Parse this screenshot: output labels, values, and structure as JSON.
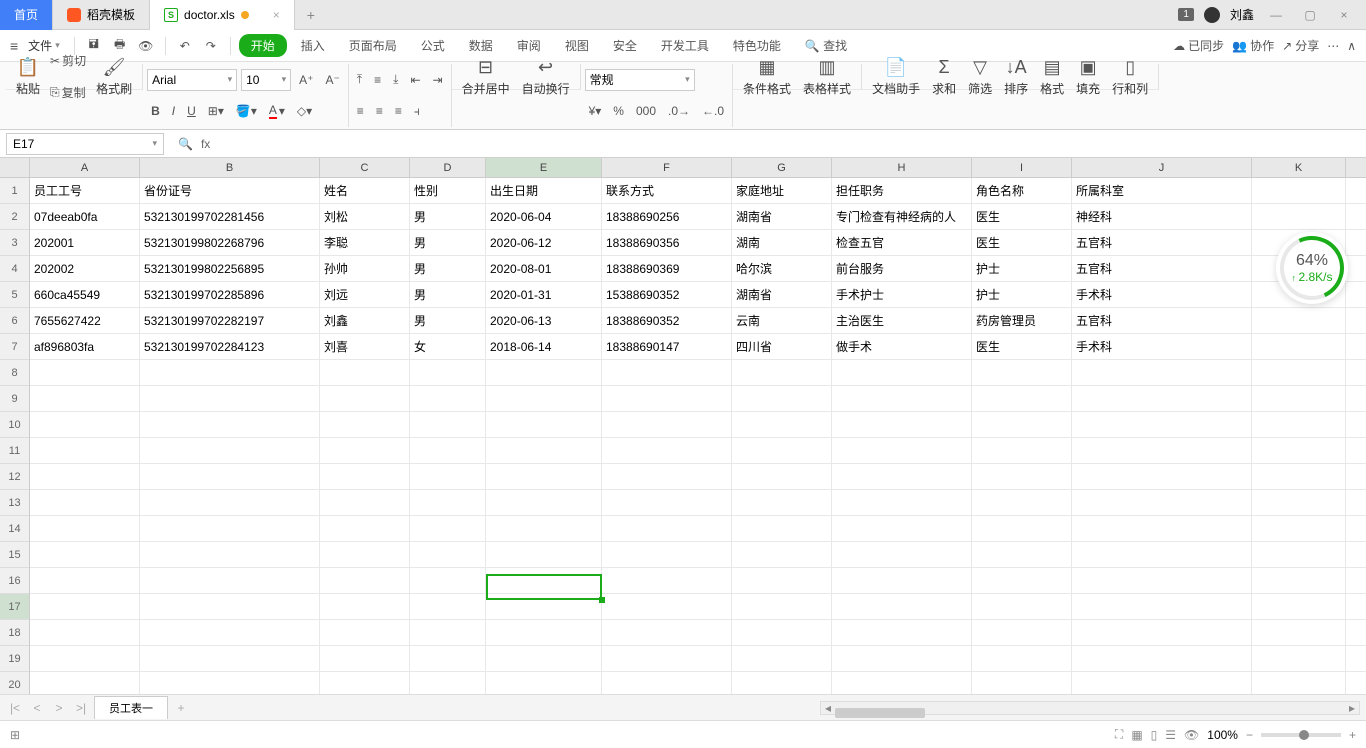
{
  "title": {
    "tab_home": "首页",
    "tab_dock": "稻壳模板",
    "tab_file": "doctor.xls",
    "user_name": "刘鑫",
    "badge": "1"
  },
  "menubar": {
    "file": "文件",
    "items": [
      "开始",
      "插入",
      "页面布局",
      "公式",
      "数据",
      "审阅",
      "视图",
      "安全",
      "开发工具",
      "特色功能"
    ],
    "search": "查找",
    "sync": "已同步",
    "collab": "协作",
    "share": "分享"
  },
  "ribbon": {
    "paste": "粘贴",
    "cut": "剪切",
    "copy": "复制",
    "format_painter": "格式刷",
    "font": "Arial",
    "size": "10",
    "merge": "合并居中",
    "wrap": "自动换行",
    "numfmt": "常规",
    "cond_fmt": "条件格式",
    "table_style": "表格样式",
    "doc_helper": "文档助手",
    "sum": "求和",
    "filter": "筛选",
    "sort": "排序",
    "format": "格式",
    "fill": "填充",
    "rowcol": "行和列"
  },
  "formula": {
    "cell_ref": "E17",
    "fx": "fx"
  },
  "columns": [
    "A",
    "B",
    "C",
    "D",
    "E",
    "F",
    "G",
    "H",
    "I",
    "J",
    "K"
  ],
  "headers": [
    "员工工号",
    "省份证号",
    "姓名",
    "性别",
    "出生日期",
    "联系方式",
    "家庭地址",
    "担任职务",
    "角色名称",
    "所属科室"
  ],
  "rows": [
    [
      "07deeab0fa",
      "532130199702281456",
      "刘松",
      "男",
      "2020-06-04",
      "18388690256",
      "湖南省",
      "专门检查有神经病的人",
      "医生",
      "神经科"
    ],
    [
      "202001",
      "532130199802268796",
      "李聪",
      "男",
      "2020-06-12",
      "18388690356",
      "湖南",
      "检查五官",
      "医生",
      "五官科"
    ],
    [
      "202002",
      "532130199802256895",
      "孙帅",
      "男",
      "2020-08-01",
      "18388690369",
      "哈尔滨",
      "前台服务",
      "护士",
      "五官科"
    ],
    [
      "660ca45549",
      "532130199702285896",
      "刘远",
      "男",
      "2020-01-31",
      "15388690352",
      "湖南省",
      "手术护士",
      "护士",
      "手术科"
    ],
    [
      "7655627422",
      "532130199702282197",
      "刘鑫",
      "男",
      "2020-06-13",
      "18388690352",
      "云南",
      "主治医生",
      "药房管理员",
      "五官科"
    ],
    [
      "af896803fa",
      "532130199702284123",
      "刘喜",
      "女",
      "2018-06-14",
      "18388690147",
      "四川省",
      "做手术",
      "医生",
      "手术科"
    ]
  ],
  "sheet": {
    "name": "员工表一"
  },
  "status": {
    "zoom": "100%"
  },
  "speed": {
    "pct": "64%",
    "rate": "2.8K/s"
  },
  "selection": {
    "row": 17,
    "col": "E"
  }
}
